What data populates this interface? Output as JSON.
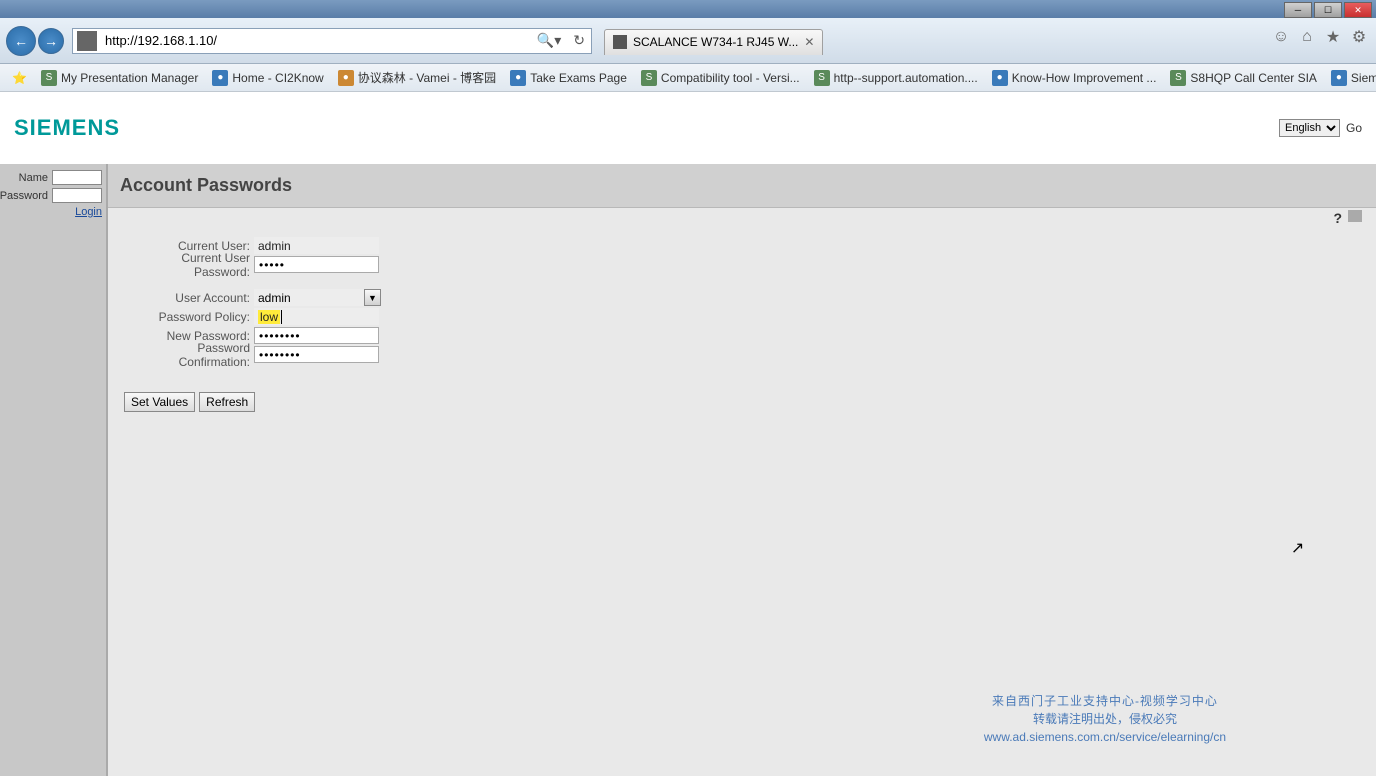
{
  "browser": {
    "url": "http://192.168.1.10/",
    "tab_title": "SCALANCE W734-1 RJ45 W...",
    "bookmarks": [
      "My Presentation Manager",
      "Home - CI2Know",
      "协议森林 - Vamei - 博客园",
      "Take Exams Page",
      "Compatibility tool - Versi...",
      "http--support.automation....",
      "Know-How Improvement ...",
      "S8HQP Call Center SIA",
      "Siemens Corporate Entitle..."
    ]
  },
  "header": {
    "logo": "SIEMENS",
    "language_selected": "English",
    "go_label": "Go"
  },
  "sidebar_login": {
    "name_label": "Name",
    "password_label": "Password",
    "login_link": "Login"
  },
  "page": {
    "title": "Account Passwords",
    "labels": {
      "current_user": "Current User:",
      "current_pw": "Current User Password:",
      "user_account": "User Account:",
      "pw_policy": "Password Policy:",
      "new_pw": "New Password:",
      "pw_confirm": "Password Confirmation:"
    },
    "values": {
      "current_user": "admin",
      "current_pw_mask": "●●●●●",
      "user_account_selected": "admin",
      "pw_policy": "low",
      "new_pw_mask": "●●●●●●●●",
      "pw_confirm_mask": "●●●●●●●●"
    },
    "buttons": {
      "set_values": "Set Values",
      "refresh": "Refresh"
    }
  },
  "watermark": {
    "line1": "来自西门子工业支持中心-视频学习中心",
    "line2": "转载请注明出处，侵权必究",
    "line3": "www.ad.siemens.com.cn/service/elearning/cn"
  }
}
